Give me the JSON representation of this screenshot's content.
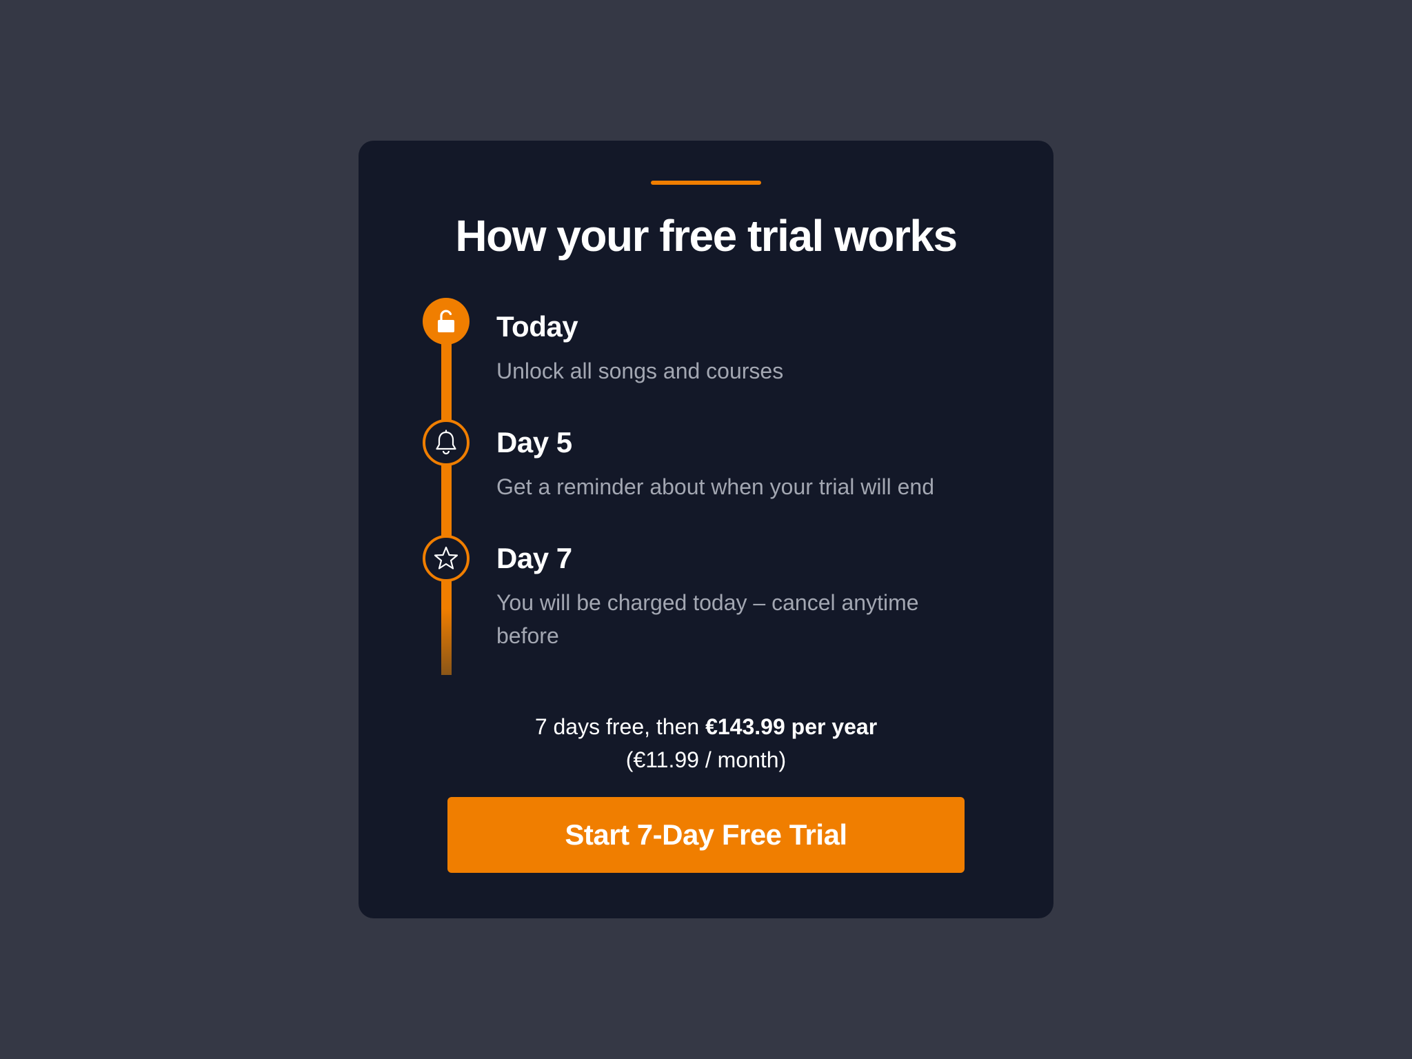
{
  "modal": {
    "title": "How your free trial works",
    "steps": [
      {
        "icon": "unlock-icon",
        "title": "Today",
        "description": "Unlock all songs and courses"
      },
      {
        "icon": "bell-icon",
        "title": "Day 5",
        "description": "Get a reminder about when your trial will end"
      },
      {
        "icon": "star-icon",
        "title": "Day 7",
        "description": "You will be charged today – cancel anytime before"
      }
    ],
    "pricing": {
      "prefix": "7 days free, then ",
      "price": "€143.99 per year",
      "monthly": "(€11.99 / month)"
    },
    "cta_label": "Start 7-Day Free Trial"
  },
  "colors": {
    "background": "#353845",
    "card": "#131828",
    "accent": "#f07e00",
    "text_primary": "#ffffff",
    "text_secondary": "#a3a7b2"
  }
}
